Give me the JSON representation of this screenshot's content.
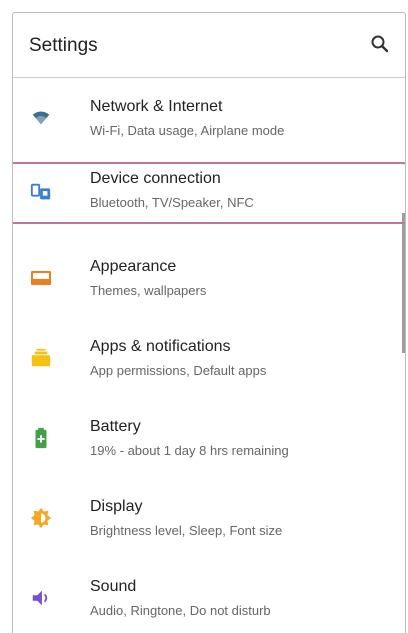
{
  "header": {
    "title": "Settings",
    "search_icon": "search-icon"
  },
  "items": [
    {
      "icon": "wifi-icon",
      "label": "Network & Internet",
      "sub": "Wi-Fi, Data usage, Airplane mode",
      "color": "#3c6e8f"
    },
    {
      "icon": "device-connection-icon",
      "label": "Device connection",
      "sub": "Bluetooth, TV/Speaker, NFC",
      "color": "#3b7fd0",
      "selected": true
    },
    {
      "icon": "appearance-icon",
      "label": "Appearance",
      "sub": "Themes, wallpapers",
      "color": "#ef7d22"
    },
    {
      "icon": "apps-icon",
      "label": "Apps & notifications",
      "sub": "App permissions, Default apps",
      "color": "#f5c213"
    },
    {
      "icon": "battery-icon",
      "label": "Battery",
      "sub": "19% - about 1 day 8 hrs remaining",
      "color": "#43a047"
    },
    {
      "icon": "display-icon",
      "label": "Display",
      "sub": "Brightness level, Sleep, Font size",
      "color": "#f5a623"
    },
    {
      "icon": "sound-icon",
      "label": "Sound",
      "sub": "Audio, Ringtone, Do not disturb",
      "color": "#7b4fc9"
    }
  ],
  "highlight_color": "#c2739b"
}
